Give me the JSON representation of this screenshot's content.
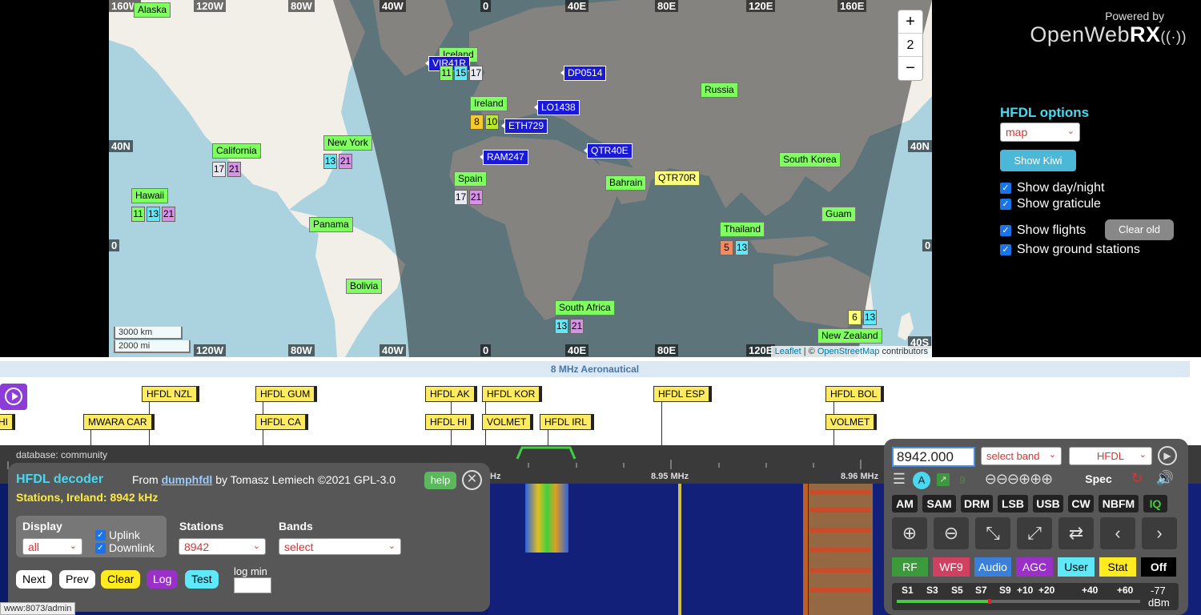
{
  "map": {
    "graticule_top": [
      "160W",
      "120W",
      "80W",
      "40W",
      "0",
      "40E",
      "80E",
      "120E",
      "160E"
    ],
    "graticule_bottom": [
      "120W",
      "80W",
      "40W",
      "0",
      "40E",
      "80E",
      "120E"
    ],
    "graticule_left": [
      "40N",
      "0"
    ],
    "graticule_right": [
      "40N",
      "0",
      "40S"
    ],
    "zoom": {
      "in": "+",
      "level": "2",
      "out": "−"
    },
    "scale_km": "3000 km",
    "scale_mi": "2000 mi",
    "attribution_leaflet": "Leaflet",
    "attribution_sep": " | © ",
    "attribution_osm": "OpenStreetMap",
    "attribution_tail": " contributors",
    "ground_stations": [
      {
        "name": "Alaska",
        "color": "g"
      },
      {
        "name": "Iceland",
        "color": "g"
      },
      {
        "name": "Ireland",
        "color": "g"
      },
      {
        "name": "Russia",
        "color": "g"
      },
      {
        "name": "California",
        "color": "g"
      },
      {
        "name": "New York",
        "color": "g"
      },
      {
        "name": "Spain",
        "color": "g"
      },
      {
        "name": "Bahrain",
        "color": "g"
      },
      {
        "name": "South Korea",
        "color": "g"
      },
      {
        "name": "Hawaii",
        "color": "g"
      },
      {
        "name": "Panama",
        "color": "g"
      },
      {
        "name": "Guam",
        "color": "g"
      },
      {
        "name": "Thailand",
        "color": "g"
      },
      {
        "name": "Bolivia",
        "color": "g"
      },
      {
        "name": "South Africa",
        "color": "g"
      },
      {
        "name": "New Zealand",
        "color": "g"
      }
    ],
    "flights": [
      "VIR41R",
      "DP0514",
      "LO1438",
      "ETH729",
      "RAM247",
      "QTR40E",
      "QTR70R"
    ],
    "freq_badges": {
      "iceland": [
        "11",
        "15",
        "17"
      ],
      "ireland": [
        "8",
        "10"
      ],
      "california": [
        "17",
        "21"
      ],
      "newyork": [
        "13",
        "21"
      ],
      "spain": [
        "17",
        "21"
      ],
      "hawaii": [
        "11",
        "13",
        "21"
      ],
      "thailand": [
        "5",
        "13"
      ],
      "southafrica": [
        "13",
        "21"
      ],
      "newzealand": [
        "6",
        "13"
      ]
    },
    "colors": {
      "land": "#f2efe9",
      "water": "#aad3df",
      "night": "rgba(0,0,0,0.45)",
      "station": "#7fff60",
      "flight": "#1a1ad6"
    }
  },
  "right": {
    "powered_by": "Powered by",
    "logo_a": "OpenWeb",
    "logo_b": "RX",
    "options_title": "HFDL options",
    "view_select": "map",
    "show_kiwi": "Show Kiwi",
    "chk_daynight": "Show day/night",
    "chk_graticule": "Show graticule",
    "chk_flights": "Show flights",
    "chk_ground": "Show ground stations",
    "clear_old": "Clear old"
  },
  "bandplan": {
    "title": "8 MHz Aeronautical",
    "markers_top": [
      "HFDL NZL",
      "HFDL GUM",
      "HFDL AK",
      "HFDL KOR",
      "HFDL ESP",
      "HFDL BOL"
    ],
    "markers_bottom": [
      "HI",
      "MWARA CAR",
      "HFDL CA",
      "HFDL HI",
      "VOLMET",
      "HFDL IRL",
      "VOLMET"
    ]
  },
  "scale": {
    "database": "database: community",
    "labels": [
      "Hz",
      "8.95 MHz",
      "8.96 MHz"
    ]
  },
  "hfdl": {
    "title": "HFDL decoder",
    "from": "From ",
    "author_link": "dumphfdl",
    "from_tail": " by Tomasz Lemiech ©2021 GPL-3.0",
    "status": "Stations, Ireland: 8942 kHz",
    "help": "help",
    "close": "✕",
    "display_label": "Display",
    "display_value": "all",
    "uplink": "Uplink",
    "downlink": "Downlink",
    "stations_label": "Stations",
    "stations_value": "8942",
    "bands_label": "Bands",
    "bands_value": "select",
    "btn_next": "Next",
    "btn_prev": "Prev",
    "btn_clear": "Clear",
    "btn_log": "Log",
    "btn_test": "Test",
    "log_min": "log min"
  },
  "receiver": {
    "frequency": "8942.000",
    "band_select": "select band",
    "mode_select": "HFDL",
    "a_badge": "A",
    "nine": "9",
    "spec": "Spec",
    "modes": [
      "AM",
      "SAM",
      "DRM",
      "LSB",
      "USB",
      "CW",
      "NBFM",
      "IQ"
    ],
    "color_buttons": [
      "RF",
      "WF9",
      "Audio",
      "AGC",
      "User",
      "Stat",
      "Off"
    ],
    "smeter_labels": [
      "S1",
      "S3",
      "S5",
      "S7",
      "S9",
      "+10",
      "+20",
      "+40",
      "+60"
    ],
    "dbm_value": "-77",
    "dbm_unit": "dBm",
    "signal_level": 0.38
  },
  "statusbar": "www:8073/admin"
}
